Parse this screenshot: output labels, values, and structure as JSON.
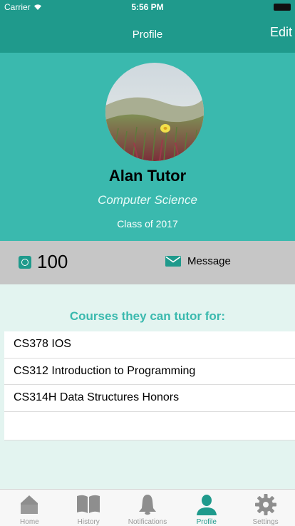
{
  "status_bar": {
    "carrier": "Carrier",
    "time": "5:56 PM"
  },
  "nav": {
    "title": "Profile",
    "edit_label": "Edit"
  },
  "profile": {
    "name": "Alan Tutor",
    "department": "Computer Science",
    "class_of": "Class of 2017"
  },
  "stats": {
    "points": "100",
    "message_label": "Message"
  },
  "courses": {
    "title": "Courses they can tutor for:",
    "items": [
      "CS378 IOS",
      "CS312 Introduction to Programming",
      "CS314H Data Structures Honors"
    ]
  },
  "tabs": [
    {
      "label": "Home",
      "icon": "home-icon"
    },
    {
      "label": "History",
      "icon": "book-icon"
    },
    {
      "label": "Notifications",
      "icon": "bell-icon"
    },
    {
      "label": "Profile",
      "icon": "person-icon",
      "active": true
    },
    {
      "label": "Settings",
      "icon": "gear-icon"
    }
  ],
  "colors": {
    "accent": "#1f9a8c",
    "header": "#3ab9ae",
    "stats_bar": "#c6c6c6",
    "background": "#e3f4f0"
  }
}
